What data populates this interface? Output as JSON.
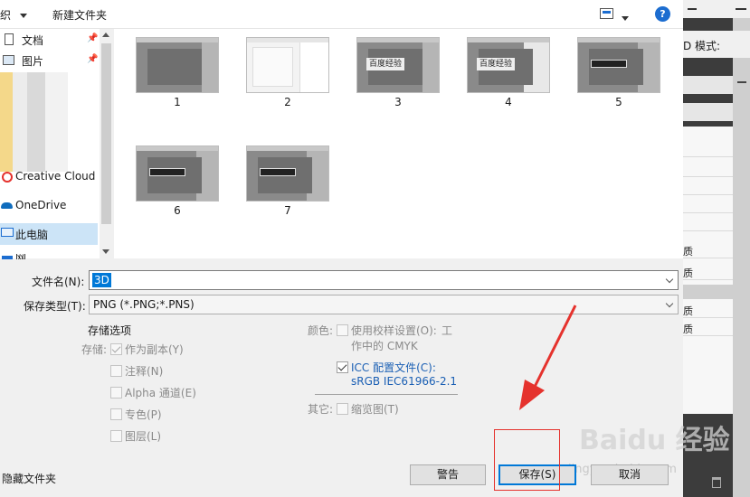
{
  "toolbar": {
    "organize_label": "织",
    "new_folder_label": "新建文件夹",
    "help_label": "?"
  },
  "nav": {
    "items": [
      {
        "label": "文档",
        "icon": "document-icon"
      },
      {
        "label": "图片",
        "icon": "picture-icon"
      },
      {
        "label": "Creative Cloud F",
        "icon": "creative-cloud-icon"
      },
      {
        "label": "OneDrive",
        "icon": "onedrive-icon"
      },
      {
        "label": "此电脑",
        "icon": "computer-icon"
      },
      {
        "label": "网",
        "icon": "network-icon"
      }
    ]
  },
  "files": [
    {
      "label": "1",
      "kind": "dark"
    },
    {
      "label": "2",
      "kind": "light"
    },
    {
      "label": "3",
      "kind": "watermark",
      "caption": "百度经验"
    },
    {
      "label": "4",
      "kind": "watermark",
      "caption": "百度经验"
    },
    {
      "label": "5",
      "kind": "3d"
    },
    {
      "label": "6",
      "kind": "3d"
    },
    {
      "label": "7",
      "kind": "3d"
    }
  ],
  "form": {
    "filename_label": "文件名(N):",
    "filename_value": "3D",
    "filetype_label": "保存类型(T):",
    "filetype_value": "PNG (*.PNG;*.PNS)"
  },
  "options": {
    "heading": "存储选项",
    "save_label": "存储:",
    "as_copy": "作为副本(Y)",
    "notes": "注释(N)",
    "alpha": "Alpha 通道(E)",
    "spot": "专色(P)",
    "layers": "图层(L)",
    "color_label": "颜色:",
    "proof_line1": "使用校样设置(O):",
    "proof_line1b": "工",
    "proof_line2": "作中的 CMYK",
    "icc_line1": "ICC 配置文件(C):",
    "icc_line2": "sRGB IEC61966-2.1",
    "other_label": "其它:",
    "thumbnail": "缩览图(T)"
  },
  "footer": {
    "hide_folders": "隐藏文件夹",
    "warning_button": "警告",
    "save_button": "保存(S)",
    "cancel_button": "取消"
  },
  "background_app": {
    "mode_label": "D 模式:",
    "rows": [
      "质",
      "质",
      "质",
      "质"
    ]
  },
  "watermark": {
    "main": "Baidu 经验",
    "sub": "jingyan.baidu.com"
  },
  "colors": {
    "accent": "#0078d7",
    "annotation": "#e5322d"
  }
}
